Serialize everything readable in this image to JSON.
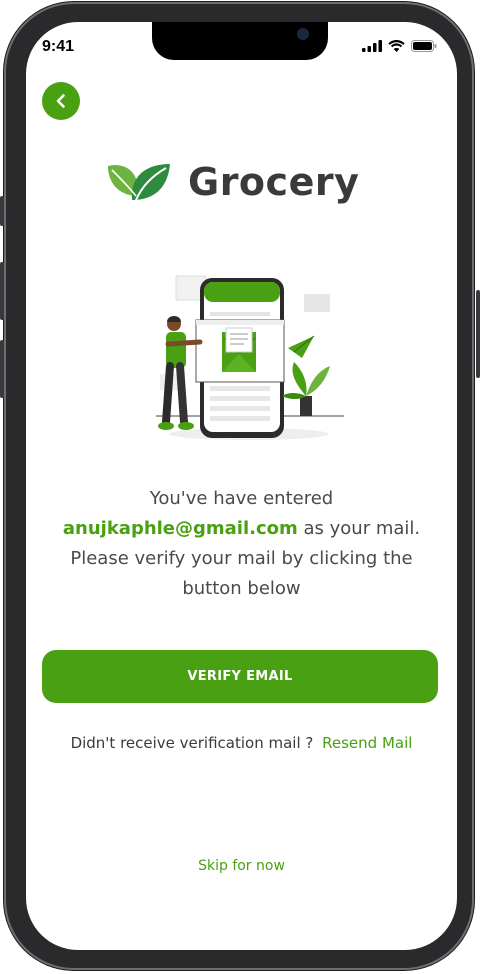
{
  "status_bar": {
    "time": "9:41"
  },
  "icons": {
    "back": "chevron-left-icon",
    "logo": "leaf-icon",
    "signal": "signal-icon",
    "wifi": "wifi-icon",
    "battery": "battery-icon"
  },
  "colors": {
    "accent": "#4aa013",
    "text": "#4a4a4a",
    "brand": "#3a3a3a"
  },
  "brand": {
    "name": "Grocery"
  },
  "message": {
    "line1": "You've have entered",
    "email": "anujkaphle@gmail.com",
    "after_email": " as your mail.",
    "line3": "Please verify your mail by clicking the",
    "line4": "button below"
  },
  "verify_button": {
    "label": "VERIFY EMAIL"
  },
  "resend": {
    "prompt": "Didn't receive verification mail ? ",
    "link": "Resend Mail"
  },
  "skip": {
    "label": "Skip for now"
  }
}
